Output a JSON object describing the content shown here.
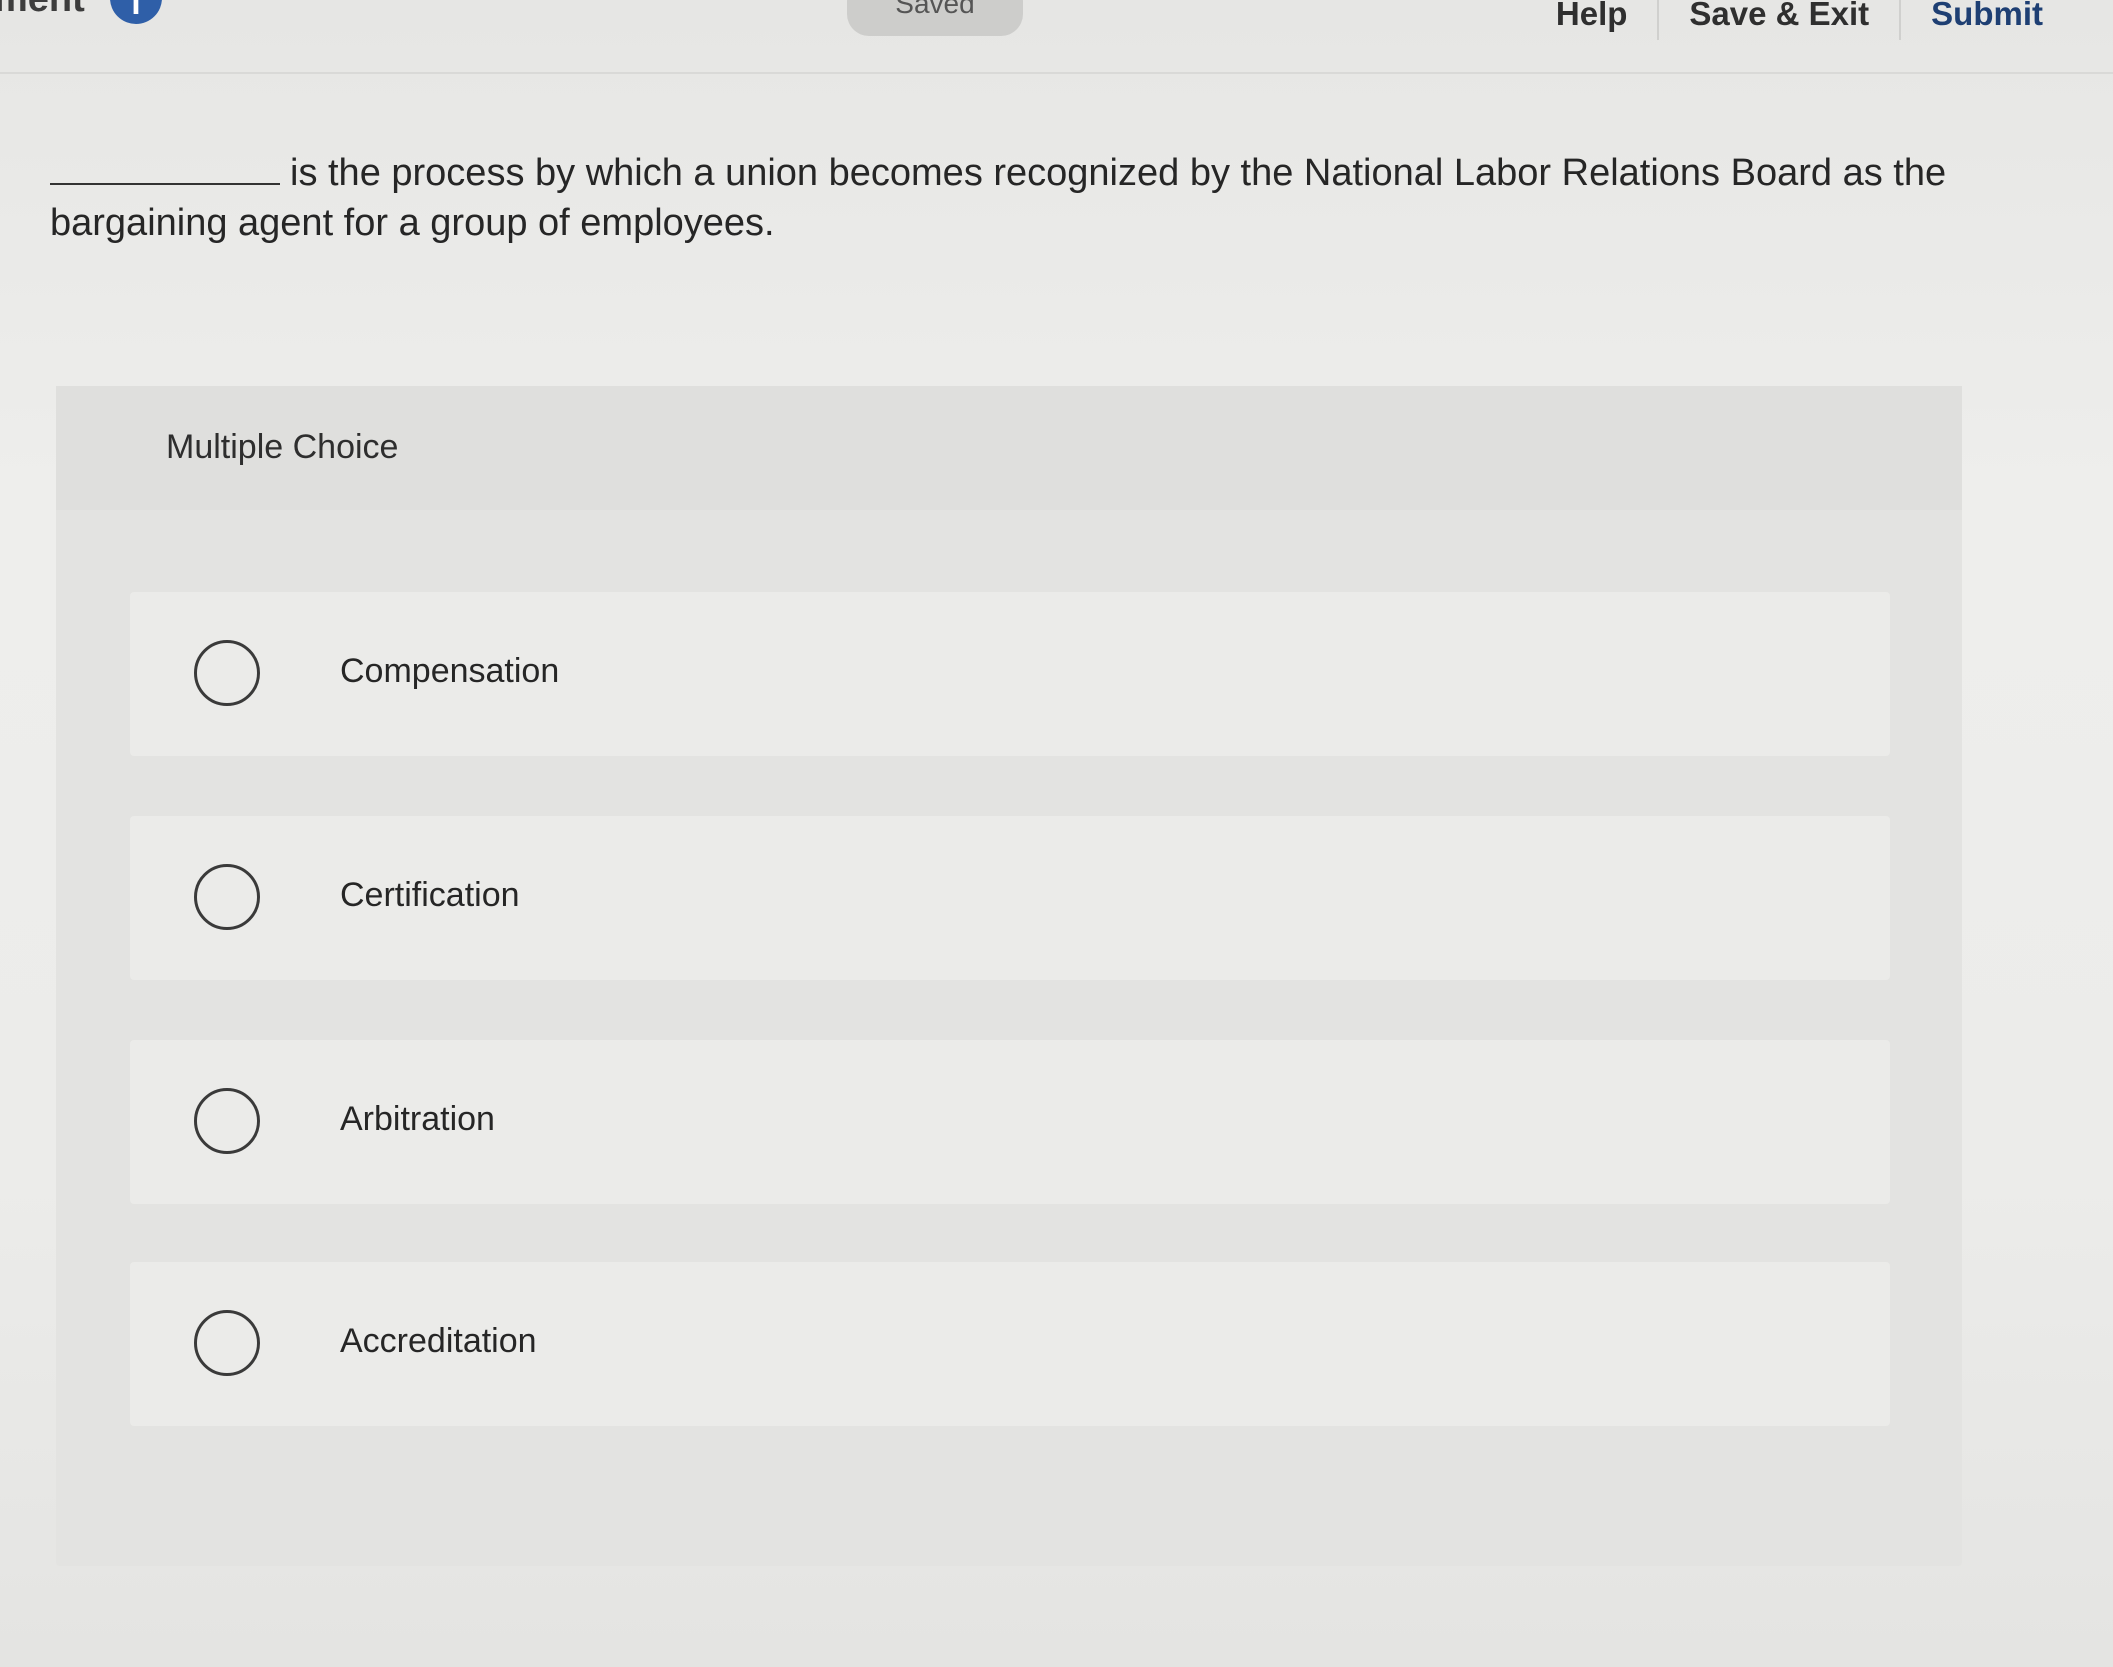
{
  "header": {
    "crumb_text": "ment",
    "info_icon": "i",
    "saved_label": "Saved",
    "help_label": "Help",
    "save_exit_label": "Save & Exit",
    "submit_label": "Submit"
  },
  "question": {
    "text": "is the process by which a union becomes recognized by the National Labor Relations Board as the bargaining agent for a group of employees."
  },
  "multiple_choice": {
    "title": "Multiple Choice",
    "options": [
      {
        "label": "Compensation"
      },
      {
        "label": "Certification"
      },
      {
        "label": "Arbitration"
      },
      {
        "label": "Accreditation"
      }
    ]
  },
  "colors": {
    "submit_link": "#1e3f73",
    "info_icon": "#2f5fa8"
  }
}
